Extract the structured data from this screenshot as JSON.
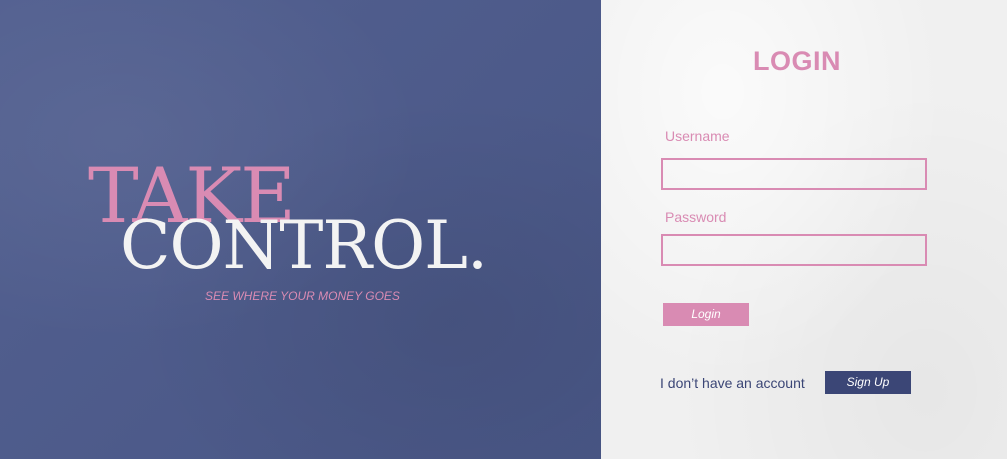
{
  "hero": {
    "headline_top": "TAKE",
    "headline_bottom": "CONTROL.",
    "tagline": "SEE WHERE YOUR MONEY GOES"
  },
  "login": {
    "title": "LOGIN",
    "username": {
      "label": "Username",
      "value": ""
    },
    "password": {
      "label": "Password",
      "value": ""
    },
    "login_button_label": "Login",
    "no_account_text": "I don’t have an account",
    "signup_button_label": "Sign Up"
  },
  "colors": {
    "hero_background": "#4c5a8c",
    "accent_pink": "#d98bb3",
    "navy": "#3b4676",
    "panel_background": "#f0f0f0",
    "headline_white": "#f3f3f3"
  }
}
